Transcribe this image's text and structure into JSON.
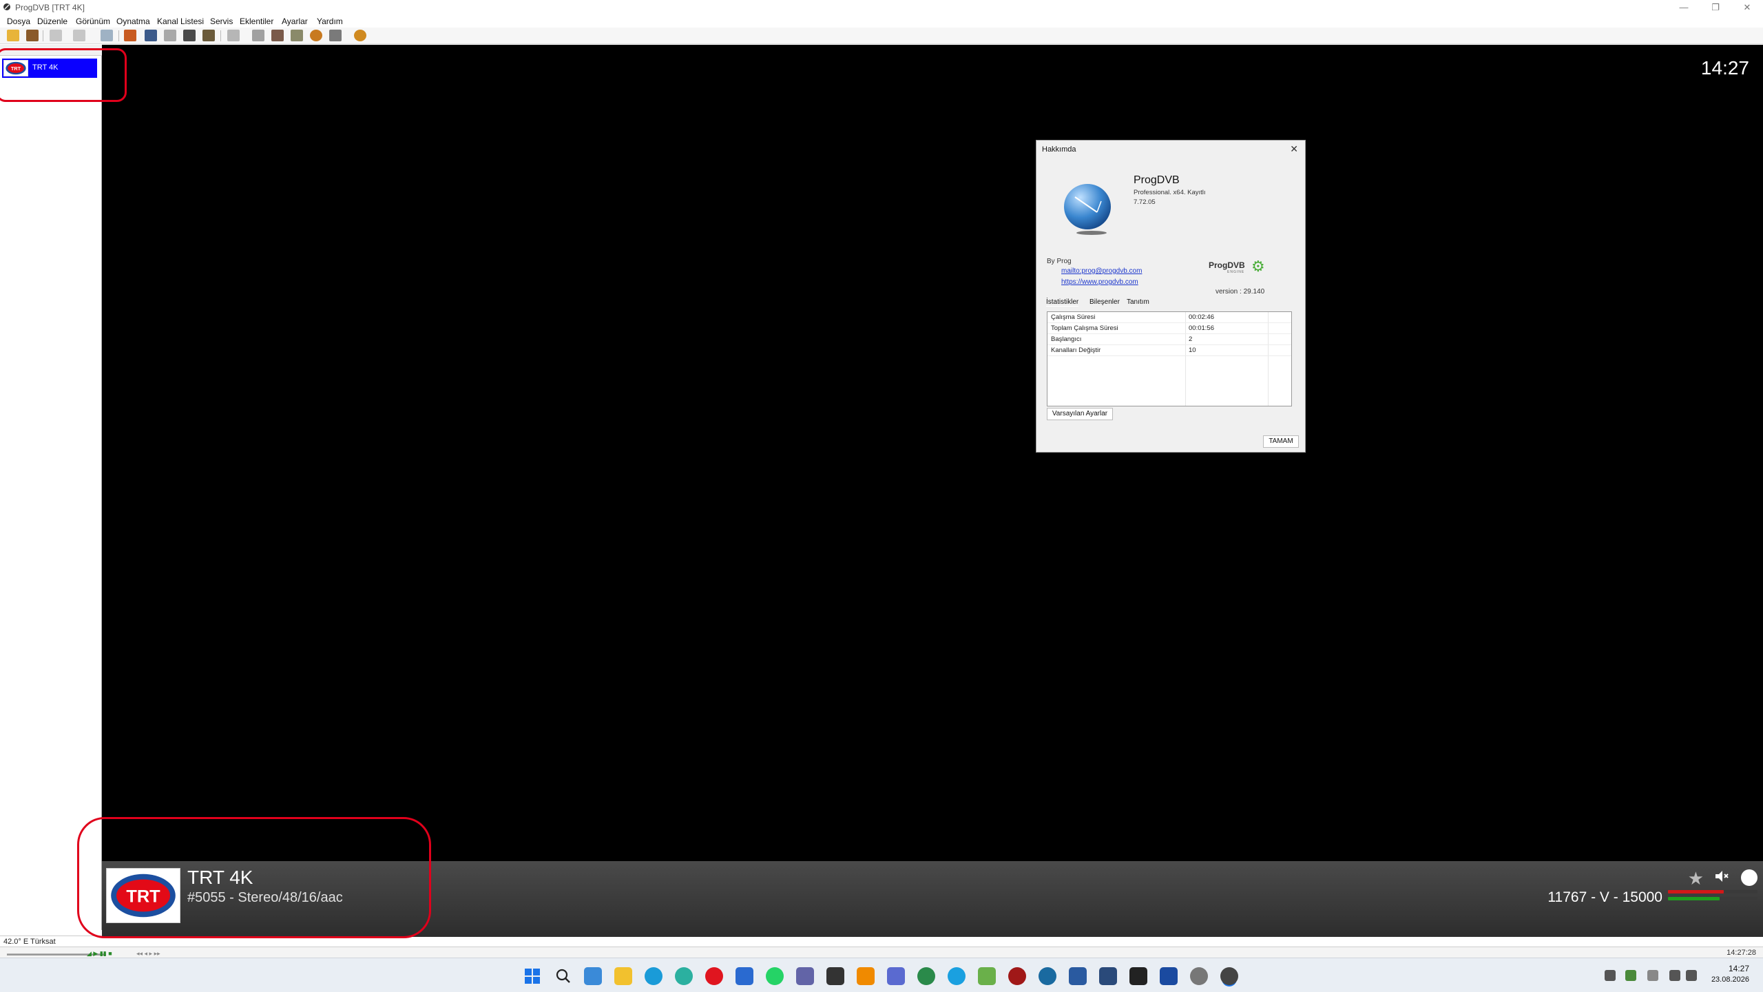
{
  "window": {
    "title": "ProgDVB [TRT 4K]",
    "minimize_glyph": "—",
    "restore_glyph": "❐",
    "close_glyph": "✕"
  },
  "menu": [
    "Dosya",
    "Düzenle",
    "Görünüm",
    "Oynatma",
    "Kanal Listesi",
    "Servis",
    "Eklentiler",
    "Ayarlar",
    "Yardım"
  ],
  "toolbar": {
    "buttons": [
      "open-icon",
      "record-icon",
      "back-icon",
      "forward-icon",
      "search-icon",
      "tv-icon",
      "monitor-icon",
      "display-icon",
      "screen-icon",
      "grid-icon",
      "link-icon",
      "plug-icon",
      "satellite-icon",
      "scan-icon",
      "disc-icon",
      "epg-icon",
      "settings-gear-icon"
    ]
  },
  "channel_list": {
    "selected": {
      "name": "TRT 4K",
      "logo_text": "TRT"
    }
  },
  "panel_status": "42.0° E Türksat",
  "video": {
    "clock": "14:27"
  },
  "osd": {
    "logo_text": "TRT",
    "channel_name": "TRT 4K",
    "stream_info": "#5055 - Stereo/48/16/aac",
    "frequency": "11767 - V - 15000",
    "star_glyph": "★",
    "signal_level": 0.62,
    "quality_level": 0.58,
    "level_colors": {
      "signal": "#d21818",
      "quality": "#1f9e1f"
    }
  },
  "about_dialog": {
    "title": "Hakkımda",
    "close_glyph": "✕",
    "app_name": "ProgDVB",
    "edition": "Professional. x64. Kayıtlı",
    "version": "7.72.05",
    "by": "By Prog",
    "email": "mailto:prog@progdvb.com",
    "website": "https://www.progdvb.com",
    "engine_name": "ProgDVB",
    "engine_sub": "ENGINE",
    "engine_version": "version : 29.140",
    "tabs": [
      "İstatistikler",
      "Bileşenler",
      "Tanıtım"
    ],
    "stats": [
      {
        "key": "Çalışma Süresi",
        "value": "00:02:46"
      },
      {
        "key": "Toplam Çalışma Süresi",
        "value": "00:01:56"
      },
      {
        "key": "Başlangıcı",
        "value": "2"
      },
      {
        "key": "Kanalları Değiştir",
        "value": "10"
      }
    ],
    "reset_button": "Varsayılan Ayarlar",
    "ok_button": "TAMAM"
  },
  "statusbar": {
    "clock": "14:27:28"
  },
  "taskbar": {
    "apps": [
      "windows-start-icon",
      "search-icon",
      "widgets-icon",
      "file-explorer-icon",
      "edge-icon",
      "edge-beta-icon",
      "opera-icon",
      "mail-icon",
      "whatsapp-icon",
      "teams-icon",
      "clapper-icon",
      "vlc-icon",
      "app-icon",
      "earth-icon",
      "browser-icon",
      "photos-icon",
      "record-app-icon",
      "steam-icon",
      "app-star-icon",
      "settings-app-icon",
      "terminal-icon",
      "store-icon",
      "settings-icon",
      "progdvb-icon"
    ],
    "time": "14:27",
    "date": "23.08.2026"
  },
  "colors": {
    "selection_blue": "#0a00ff",
    "annotation_red": "#e0001b",
    "link_blue": "#1a35cc",
    "trt_red": "#e30a17",
    "trt_blue": "#1c4fa0"
  }
}
